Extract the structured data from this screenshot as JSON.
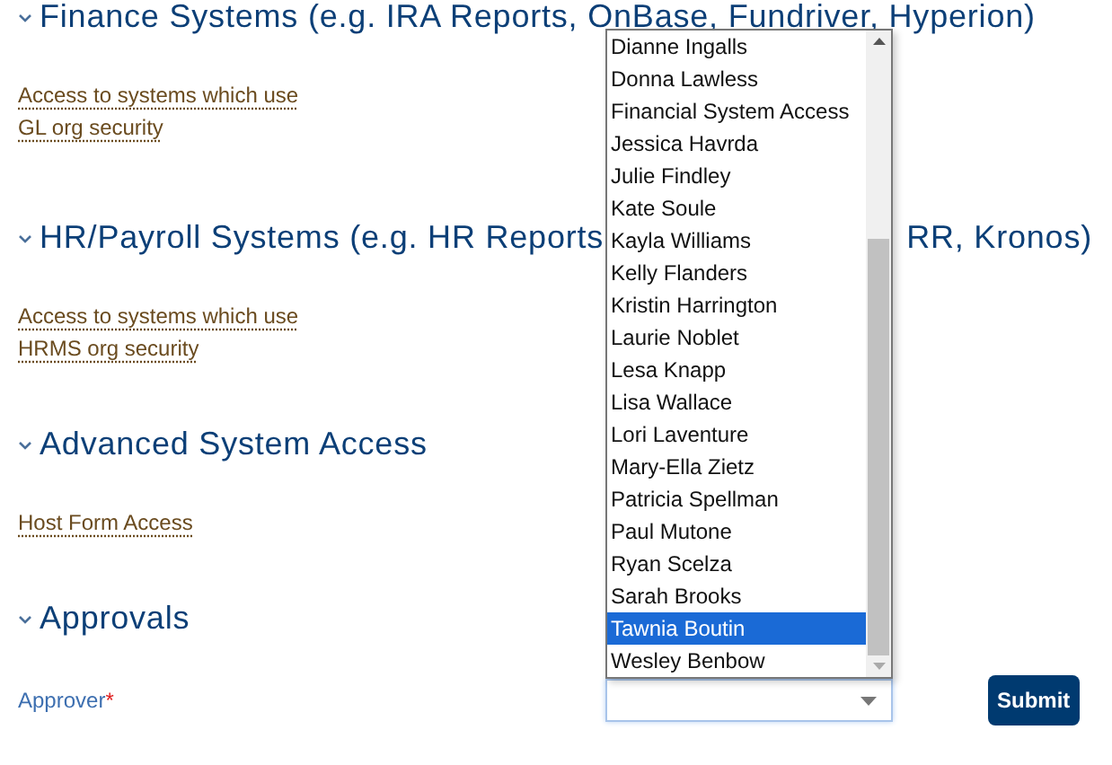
{
  "sections": [
    {
      "heading": [
        "Finance Systems (e.g. IRA Reports, OnBase, Fundriver, Hyperion)"
      ],
      "expanded": true,
      "links": [
        "Access to systems which use GL org security"
      ]
    },
    {
      "heading": [
        "HR/Payroll Systems (e.g. HR Reports",
        "RR, Kronos)"
      ],
      "expanded": true,
      "links": [
        "Access to systems which use HRMS org security"
      ]
    },
    {
      "heading": [
        "Advanced System Access"
      ],
      "expanded": true,
      "links": [
        "Host Form Access"
      ]
    },
    {
      "heading": [
        "Approvals"
      ],
      "expanded": true
    }
  ],
  "approver": {
    "label": "Approver",
    "required_mark": "*",
    "options": [
      {
        "label": "Dianne Ingalls",
        "selected": false
      },
      {
        "label": "Donna Lawless",
        "selected": false
      },
      {
        "label": "Financial System Access",
        "selected": false
      },
      {
        "label": "Jessica Havrda",
        "selected": false
      },
      {
        "label": "Julie Findley",
        "selected": false
      },
      {
        "label": "Kate Soule",
        "selected": false
      },
      {
        "label": "Kayla Williams",
        "selected": false
      },
      {
        "label": "Kelly Flanders",
        "selected": false
      },
      {
        "label": "Kristin Harrington",
        "selected": false
      },
      {
        "label": "Laurie Noblet",
        "selected": false
      },
      {
        "label": "Lesa Knapp",
        "selected": false
      },
      {
        "label": "Lisa Wallace",
        "selected": false
      },
      {
        "label": "Lori Laventure",
        "selected": false
      },
      {
        "label": "Mary-Ella Zietz",
        "selected": false
      },
      {
        "label": "Patricia Spellman",
        "selected": false
      },
      {
        "label": "Paul Mutone",
        "selected": false
      },
      {
        "label": "Ryan Scelza",
        "selected": false
      },
      {
        "label": "Sarah Brooks",
        "selected": false
      },
      {
        "label": "Tawnia Boutin",
        "selected": true
      },
      {
        "label": "Wesley Benbow",
        "selected": false
      }
    ]
  },
  "submit": "Submit"
}
